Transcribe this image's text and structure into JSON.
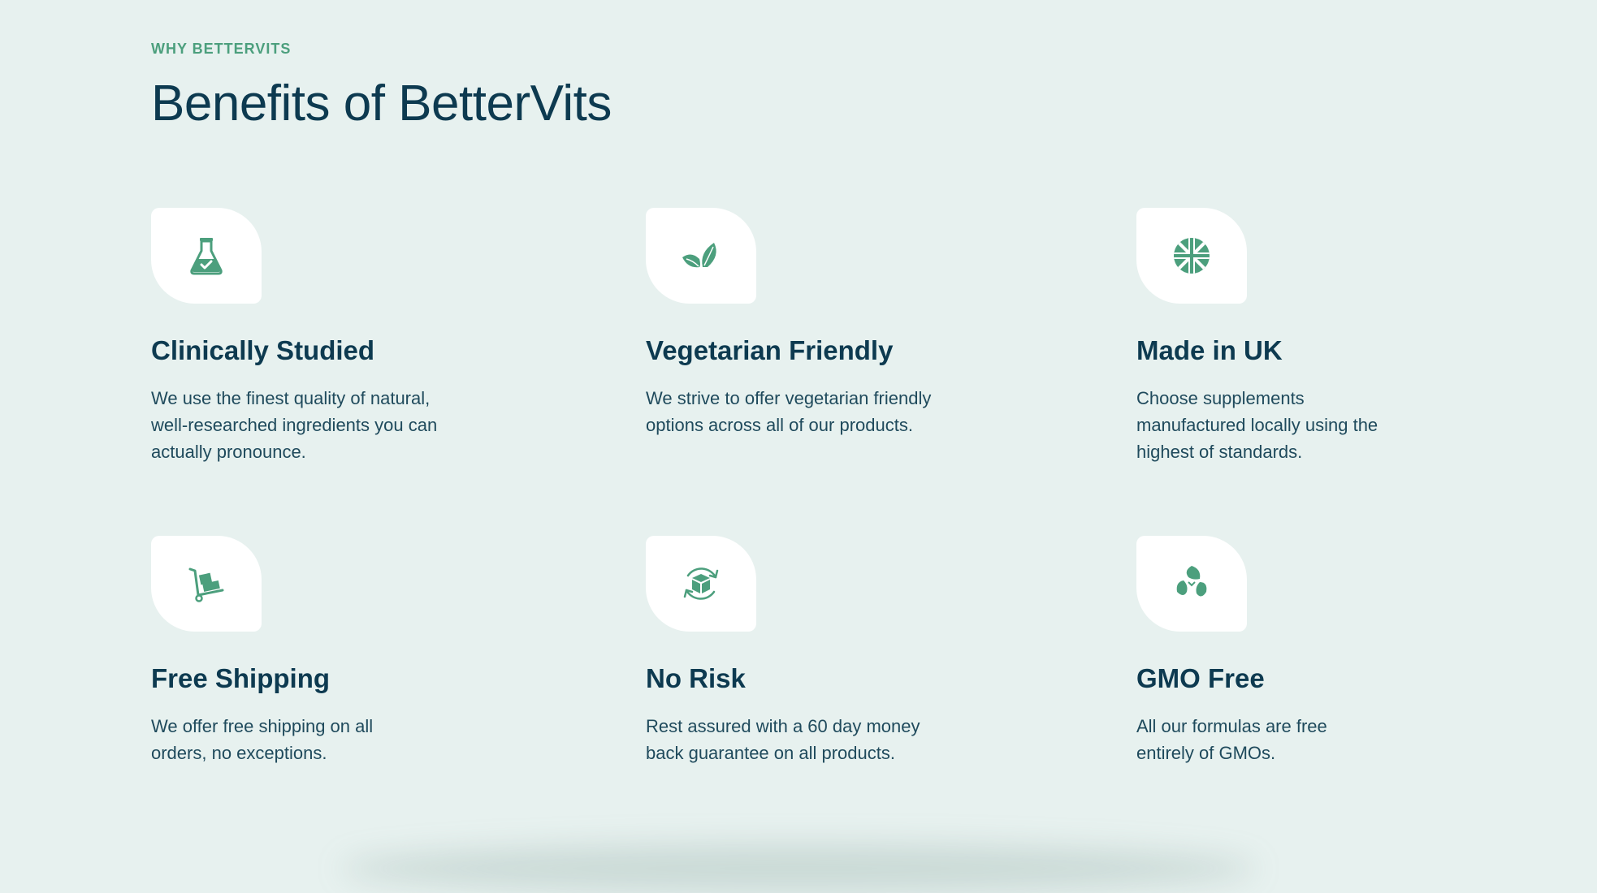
{
  "section": {
    "eyebrow": "WHY BETTERVITS",
    "title": "Benefits of BetterVits"
  },
  "benefits": [
    {
      "title": "Clinically Studied",
      "text": "We use the finest quality of natural, well-researched ingredients you can actually pronounce.",
      "icon": "flask-icon"
    },
    {
      "title": "Vegetarian Friendly",
      "text": "We strive to offer vegetarian friendly options across all of our products.",
      "icon": "leaves-icon"
    },
    {
      "title": "Made in UK",
      "text": "Choose supplements manufactured locally using the highest of standards.",
      "icon": "uk-flag-icon"
    },
    {
      "title": "Free Shipping",
      "text": "We offer free shipping on all orders, no exceptions.",
      "icon": "hand-truck-icon"
    },
    {
      "title": "No Risk",
      "text": "Rest assured with a 60 day money back guarantee on all products.",
      "icon": "box-return-icon"
    },
    {
      "title": "GMO Free",
      "text": "All our formulas are free entirely of GMOs.",
      "icon": "recycle-leaves-icon"
    }
  ],
  "colors": {
    "background": "#e7f1ef",
    "accent": "#4c9f7d",
    "heading": "#0d3a50",
    "tile": "#ffffff"
  }
}
